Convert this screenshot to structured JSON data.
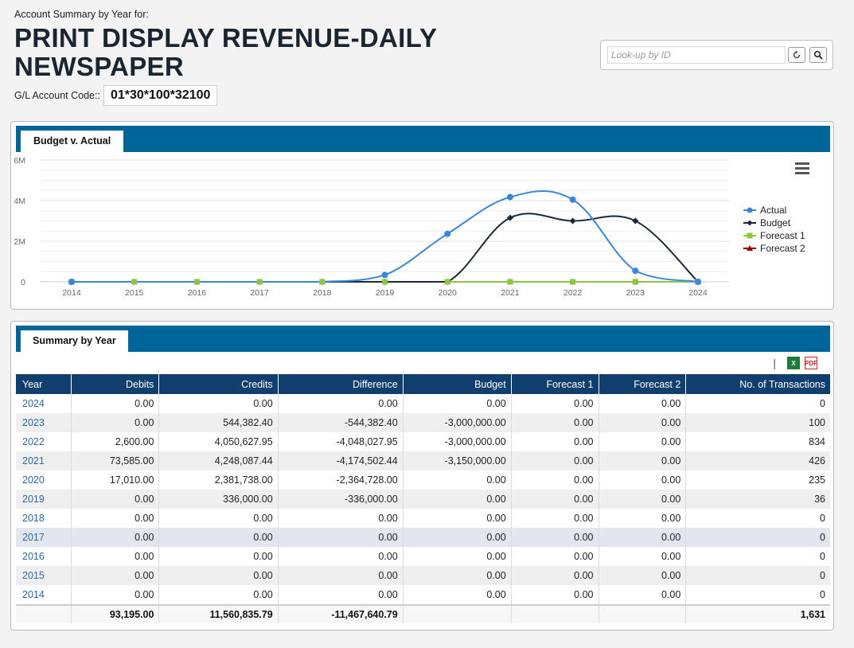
{
  "header": {
    "subtitle": "Account Summary by Year for:",
    "title": "PRINT DISPLAY REVENUE-DAILY NEWSPAPER",
    "gl_label": "G/L Account Code::",
    "gl_code": "01*30*100*32100"
  },
  "lookup": {
    "placeholder": "Look-up by ID"
  },
  "chart_panel": {
    "tab_label": "Budget v. Actual"
  },
  "chart_data": {
    "type": "line",
    "title": "",
    "xlabel": "",
    "ylabel": "",
    "x": [
      2014,
      2015,
      2016,
      2017,
      2018,
      2019,
      2020,
      2021,
      2022,
      2023,
      2024
    ],
    "y_ticks": [
      "0",
      "2M",
      "4M",
      "6M"
    ],
    "ylim": [
      0,
      6000000
    ],
    "grid": true,
    "legend_position": "right",
    "series": [
      {
        "name": "Actual",
        "color": "#3a87d6",
        "marker": "circle",
        "values": [
          0,
          0,
          0,
          0,
          0,
          336000,
          2364728,
          4174524,
          4048028,
          544382,
          0
        ]
      },
      {
        "name": "Budget",
        "color": "#1b2a3a",
        "marker": "diamond",
        "values": [
          0,
          0,
          0,
          0,
          0,
          0,
          0,
          3150000,
          3000000,
          3000000,
          0
        ]
      },
      {
        "name": "Forecast 1",
        "color": "#8cc63f",
        "marker": "square",
        "values": [
          0,
          0,
          0,
          0,
          0,
          0,
          0,
          0,
          0,
          0,
          0
        ]
      },
      {
        "name": "Forecast 2",
        "color": "#8b0000",
        "marker": "triangle",
        "values": [
          0,
          0,
          0,
          0,
          0,
          0,
          0,
          0,
          0,
          0,
          0
        ]
      }
    ]
  },
  "summary_panel": {
    "tab_label": "Summary by Year"
  },
  "table": {
    "columns": [
      "Year",
      "Debits",
      "Credits",
      "Difference",
      "Budget",
      "Forecast 1",
      "Forecast 2",
      "No. of Transactions"
    ],
    "rows": [
      [
        "2024",
        "0.00",
        "0.00",
        "0.00",
        "0.00",
        "0.00",
        "0.00",
        "0"
      ],
      [
        "2023",
        "0.00",
        "544,382.40",
        "-544,382.40",
        "-3,000,000.00",
        "0.00",
        "0.00",
        "100"
      ],
      [
        "2022",
        "2,600.00",
        "4,050,627.95",
        "-4,048,027.95",
        "-3,000,000.00",
        "0.00",
        "0.00",
        "834"
      ],
      [
        "2021",
        "73,585.00",
        "4,248,087.44",
        "-4,174,502.44",
        "-3,150,000.00",
        "0.00",
        "0.00",
        "426"
      ],
      [
        "2020",
        "17,010.00",
        "2,381,738.00",
        "-2,364,728.00",
        "0.00",
        "0.00",
        "0.00",
        "235"
      ],
      [
        "2019",
        "0.00",
        "336,000.00",
        "-336,000.00",
        "0.00",
        "0.00",
        "0.00",
        "36"
      ],
      [
        "2018",
        "0.00",
        "0.00",
        "0.00",
        "0.00",
        "0.00",
        "0.00",
        "0"
      ],
      [
        "2017",
        "0.00",
        "0.00",
        "0.00",
        "0.00",
        "0.00",
        "0.00",
        "0"
      ],
      [
        "2016",
        "0.00",
        "0.00",
        "0.00",
        "0.00",
        "0.00",
        "0.00",
        "0"
      ],
      [
        "2015",
        "0.00",
        "0.00",
        "0.00",
        "0.00",
        "0.00",
        "0.00",
        "0"
      ],
      [
        "2014",
        "0.00",
        "0.00",
        "0.00",
        "0.00",
        "0.00",
        "0.00",
        "0"
      ]
    ],
    "totals": [
      "",
      "93,195.00",
      "11,560,835.79",
      "-11,467,640.79",
      "",
      "",
      "",
      "1,631"
    ]
  },
  "export": {
    "xls_text": "X",
    "pdf_text": "PDF"
  },
  "icons": {
    "menu": "hamburger-menu-icon",
    "refresh": "refresh-icon",
    "search": "search-icon",
    "excel": "excel-icon",
    "pdf": "pdf-icon"
  }
}
